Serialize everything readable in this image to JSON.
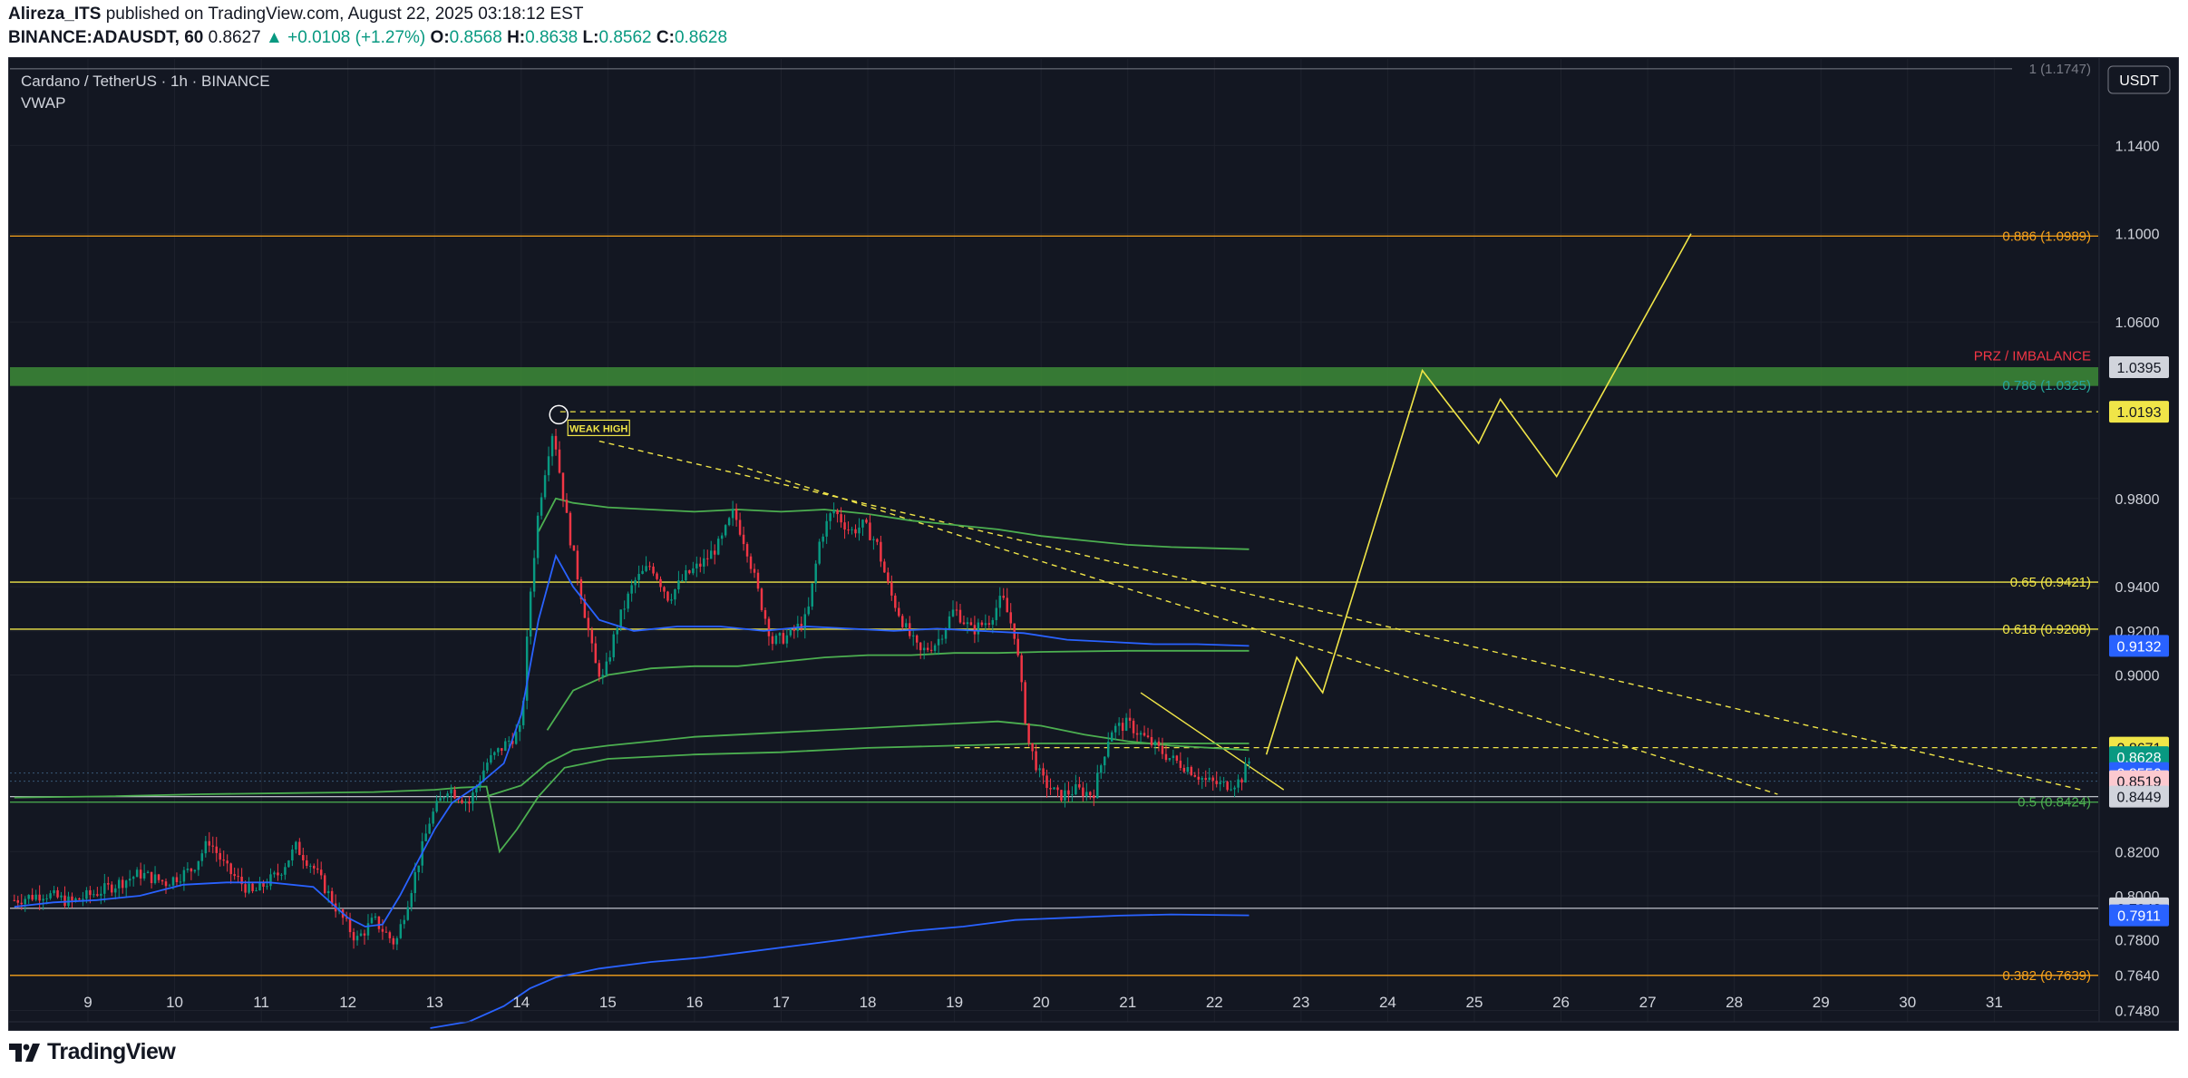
{
  "header": {
    "author": "Alireza_ITS",
    "published": "published on TradingView.com, August 22, 2025 03:18:12 EST",
    "symbol": "BINANCE:ADAUSDT, 60",
    "price": "0.8627",
    "change": "+0.0108 (+1.27%)",
    "o_label": "O:",
    "o": "0.8568",
    "h_label": "H:",
    "h": "0.8638",
    "l_label": "L:",
    "l": "0.8562",
    "c_label": "C:",
    "c": "0.8628"
  },
  "legend": {
    "title": "Cardano / TetherUS · 1h · BINANCE",
    "indicator": "VWAP"
  },
  "footer": {
    "brand": "TradingView"
  },
  "colors": {
    "bg": "#131722",
    "grid": "#1e222d",
    "up": "#089981",
    "down": "#f23645",
    "fib_orange": "#f7a21b",
    "fib_yellow": "#f0e548",
    "fib_green": "#4caf50",
    "vwap_blue": "#2962ff",
    "band_green": "#4caf50",
    "zone": "#3d8b37",
    "axis_text": "#d1d4dc"
  },
  "chart_data": {
    "type": "candlestick",
    "title": "Cardano / TetherUS · 1h · BINANCE",
    "x_axis": {
      "type": "date",
      "unit": "day",
      "range": [
        8.1,
        32.2
      ],
      "tick_labels": [
        "9",
        "10",
        "11",
        "12",
        "13",
        "14",
        "15",
        "16",
        "17",
        "18",
        "19",
        "20",
        "21",
        "22",
        "23",
        "24",
        "25",
        "26",
        "27",
        "28",
        "29",
        "30",
        "31"
      ]
    },
    "y_axis": {
      "currency": "USDT",
      "range": [
        0.74,
        1.18
      ],
      "tick_labels": [
        "1.1400",
        "1.1000",
        "1.0600",
        "0.9800",
        "0.9400",
        "0.9200",
        "0.9000",
        "0.8200",
        "0.8000",
        "0.7800",
        "0.7640",
        "0.7480"
      ]
    },
    "candle_path": [
      [
        8.15,
        0.798
      ],
      [
        8.5,
        0.801
      ],
      [
        8.8,
        0.797
      ],
      [
        9.2,
        0.803
      ],
      [
        9.6,
        0.81
      ],
      [
        9.9,
        0.806
      ],
      [
        10.2,
        0.812
      ],
      [
        10.4,
        0.825
      ],
      [
        10.6,
        0.812
      ],
      [
        10.9,
        0.801
      ],
      [
        11.2,
        0.81
      ],
      [
        11.4,
        0.822
      ],
      [
        11.6,
        0.813
      ],
      [
        11.9,
        0.792
      ],
      [
        12.1,
        0.78
      ],
      [
        12.3,
        0.789
      ],
      [
        12.55,
        0.778
      ],
      [
        12.75,
        0.806
      ],
      [
        12.95,
        0.835
      ],
      [
        13.15,
        0.849
      ],
      [
        13.4,
        0.842
      ],
      [
        13.6,
        0.86
      ],
      [
        13.85,
        0.87
      ],
      [
        14.0,
        0.875
      ],
      [
        14.1,
        0.935
      ],
      [
        14.2,
        0.975
      ],
      [
        14.3,
        0.999
      ],
      [
        14.37,
        1.012
      ],
      [
        14.45,
        0.99
      ],
      [
        14.55,
        0.965
      ],
      [
        14.7,
        0.935
      ],
      [
        14.85,
        0.905
      ],
      [
        14.95,
        0.898
      ],
      [
        15.1,
        0.922
      ],
      [
        15.3,
        0.942
      ],
      [
        15.5,
        0.95
      ],
      [
        15.7,
        0.935
      ],
      [
        15.9,
        0.945
      ],
      [
        16.1,
        0.951
      ],
      [
        16.3,
        0.96
      ],
      [
        16.45,
        0.974
      ],
      [
        16.6,
        0.958
      ],
      [
        16.75,
        0.935
      ],
      [
        16.9,
        0.915
      ],
      [
        17.1,
        0.918
      ],
      [
        17.3,
        0.926
      ],
      [
        17.45,
        0.962
      ],
      [
        17.6,
        0.975
      ],
      [
        17.8,
        0.965
      ],
      [
        17.95,
        0.968
      ],
      [
        18.1,
        0.96
      ],
      [
        18.25,
        0.938
      ],
      [
        18.45,
        0.92
      ],
      [
        18.6,
        0.91
      ],
      [
        18.8,
        0.915
      ],
      [
        19.0,
        0.93
      ],
      [
        19.2,
        0.92
      ],
      [
        19.4,
        0.925
      ],
      [
        19.55,
        0.935
      ],
      [
        19.7,
        0.918
      ],
      [
        19.85,
        0.87
      ],
      [
        20.0,
        0.853
      ],
      [
        20.2,
        0.845
      ],
      [
        20.4,
        0.848
      ],
      [
        20.6,
        0.846
      ],
      [
        20.8,
        0.875
      ],
      [
        21.0,
        0.878
      ],
      [
        21.15,
        0.873
      ],
      [
        21.3,
        0.868
      ],
      [
        21.5,
        0.862
      ],
      [
        21.7,
        0.858
      ],
      [
        21.9,
        0.852
      ],
      [
        22.1,
        0.85
      ],
      [
        22.3,
        0.852
      ],
      [
        22.42,
        0.8628
      ]
    ],
    "vwap_main": [
      [
        8.15,
        0.795
      ],
      [
        8.6,
        0.797
      ],
      [
        9.1,
        0.798
      ],
      [
        9.6,
        0.8
      ],
      [
        10.1,
        0.805
      ],
      [
        10.6,
        0.806
      ],
      [
        11.1,
        0.806
      ],
      [
        11.6,
        0.804
      ],
      [
        11.8,
        0.797
      ],
      [
        12.0,
        0.79
      ],
      [
        12.2,
        0.786
      ],
      [
        12.4,
        0.787
      ],
      [
        12.6,
        0.8
      ],
      [
        12.8,
        0.815
      ],
      [
        13.0,
        0.83
      ],
      [
        13.2,
        0.842
      ],
      [
        13.5,
        0.85
      ],
      [
        13.8,
        0.86
      ],
      [
        14.0,
        0.882
      ],
      [
        14.2,
        0.925
      ],
      [
        14.4,
        0.954
      ],
      [
        14.6,
        0.94
      ],
      [
        14.9,
        0.925
      ],
      [
        15.3,
        0.92
      ],
      [
        15.8,
        0.922
      ],
      [
        16.3,
        0.922
      ],
      [
        16.8,
        0.92
      ],
      [
        17.3,
        0.922
      ],
      [
        17.8,
        0.921
      ],
      [
        18.3,
        0.92
      ],
      [
        18.8,
        0.921
      ],
      [
        19.3,
        0.92
      ],
      [
        19.8,
        0.919
      ],
      [
        20.3,
        0.916
      ],
      [
        20.8,
        0.915
      ],
      [
        21.3,
        0.914
      ],
      [
        21.8,
        0.914
      ],
      [
        22.4,
        0.9132
      ]
    ],
    "vwap_low": [
      [
        12.95,
        0.74
      ],
      [
        13.4,
        0.743
      ],
      [
        13.8,
        0.75
      ],
      [
        14.1,
        0.758
      ],
      [
        14.4,
        0.763
      ],
      [
        14.9,
        0.767
      ],
      [
        15.5,
        0.77
      ],
      [
        16.1,
        0.772
      ],
      [
        16.7,
        0.775
      ],
      [
        17.3,
        0.778
      ],
      [
        17.9,
        0.781
      ],
      [
        18.5,
        0.784
      ],
      [
        19.1,
        0.786
      ],
      [
        19.7,
        0.789
      ],
      [
        20.3,
        0.79
      ],
      [
        20.9,
        0.791
      ],
      [
        21.5,
        0.7915
      ],
      [
        22.4,
        0.7911
      ]
    ],
    "band_upper1": [
      [
        14.2,
        0.965
      ],
      [
        14.4,
        0.98
      ],
      [
        14.6,
        0.978
      ],
      [
        15.0,
        0.976
      ],
      [
        15.5,
        0.975
      ],
      [
        16.0,
        0.974
      ],
      [
        16.5,
        0.975
      ],
      [
        17.0,
        0.974
      ],
      [
        17.5,
        0.975
      ],
      [
        18.0,
        0.973
      ],
      [
        18.5,
        0.97
      ],
      [
        19.0,
        0.968
      ],
      [
        19.5,
        0.966
      ],
      [
        20.0,
        0.963
      ],
      [
        20.5,
        0.961
      ],
      [
        21.0,
        0.959
      ],
      [
        21.5,
        0.958
      ],
      [
        22.4,
        0.957
      ]
    ],
    "band_upper2": [
      [
        14.3,
        0.875
      ],
      [
        14.6,
        0.893
      ],
      [
        15.0,
        0.9
      ],
      [
        15.5,
        0.903
      ],
      [
        16.0,
        0.904
      ],
      [
        16.5,
        0.904
      ],
      [
        17.0,
        0.906
      ],
      [
        17.5,
        0.908
      ],
      [
        18.0,
        0.909
      ],
      [
        18.5,
        0.909
      ],
      [
        19.0,
        0.91
      ],
      [
        19.5,
        0.91
      ],
      [
        20.0,
        0.9105
      ],
      [
        21.0,
        0.911
      ],
      [
        22.4,
        0.911
      ]
    ],
    "band_lower": [
      [
        13.6,
        0.845
      ],
      [
        14.0,
        0.85
      ],
      [
        14.3,
        0.86
      ],
      [
        14.6,
        0.866
      ],
      [
        15.0,
        0.868
      ],
      [
        15.5,
        0.87
      ],
      [
        16.0,
        0.872
      ],
      [
        16.5,
        0.873
      ],
      [
        17.0,
        0.874
      ],
      [
        17.5,
        0.875
      ],
      [
        18.0,
        0.876
      ],
      [
        18.5,
        0.877
      ],
      [
        19.0,
        0.878
      ],
      [
        19.5,
        0.879
      ],
      [
        20.0,
        0.877
      ],
      [
        20.5,
        0.873
      ],
      [
        21.0,
        0.87
      ],
      [
        21.5,
        0.868
      ],
      [
        22.4,
        0.866
      ]
    ],
    "band_lowest": [
      [
        8.15,
        0.8445
      ],
      [
        9.2,
        0.845
      ],
      [
        10.3,
        0.846
      ],
      [
        11.3,
        0.8465
      ],
      [
        12.3,
        0.847
      ],
      [
        13.0,
        0.848
      ],
      [
        13.3,
        0.849
      ],
      [
        13.6,
        0.8495
      ],
      [
        13.75,
        0.82
      ],
      [
        13.95,
        0.83
      ],
      [
        14.2,
        0.845
      ],
      [
        14.5,
        0.858
      ],
      [
        15.0,
        0.862
      ],
      [
        16.0,
        0.864
      ],
      [
        17.0,
        0.865
      ],
      [
        18.0,
        0.867
      ],
      [
        19.0,
        0.868
      ],
      [
        20.0,
        0.869
      ],
      [
        21.0,
        0.869
      ],
      [
        22.4,
        0.869
      ]
    ],
    "fib_levels": [
      {
        "label": "0.886 (1.0989)",
        "value": 1.0989,
        "color": "orange"
      },
      {
        "label": "PRZ / IMBALANCE",
        "value": 1.041,
        "color": "red"
      },
      {
        "label": "0.786 (1.0325)",
        "value": 1.0325,
        "color": "teal"
      },
      {
        "label": "0.65 (0.9421)",
        "value": 0.9421,
        "color": "yellow"
      },
      {
        "label": "0.618 (0.9208)",
        "value": 0.9208,
        "color": "yellow"
      },
      {
        "label": "0.5 (0.8424)",
        "value": 0.8424,
        "color": "green"
      },
      {
        "label": "0.382 (0.7639)",
        "value": 0.7639,
        "color": "orange"
      }
    ],
    "top_right_label": "1 (1.1747)",
    "zone": {
      "from": 1.031,
      "to": 1.0395
    },
    "price_badges": [
      {
        "text": "1.0395",
        "value": 1.0395,
        "bg": "#d1d4dc",
        "fg": "#131722"
      },
      {
        "text": "1.0193",
        "value": 1.0193,
        "bg": "#f0e548",
        "fg": "#131722"
      },
      {
        "text": "0.9132",
        "value": 0.9132,
        "bg": "#2962ff",
        "fg": "#ffffff"
      },
      {
        "text": "0.8671",
        "value": 0.8671,
        "bg": "#f0e548",
        "fg": "#131722"
      },
      {
        "text": "0.8628",
        "value": 0.8628,
        "bg": "#089981",
        "fg": "#ffffff",
        "sub": "41:49"
      },
      {
        "text": "0.8556",
        "value": 0.8556,
        "bg": "#2962ff",
        "fg": "#ffffff"
      },
      {
        "text": "0.8519",
        "value": 0.8519,
        "bg": "#fcc9cf",
        "fg": "#131722"
      },
      {
        "text": "0.8449",
        "value": 0.8449,
        "bg": "#d1d4dc",
        "fg": "#131722"
      },
      {
        "text": "0.7943",
        "value": 0.7943,
        "bg": "#d1d4dc",
        "fg": "#131722"
      },
      {
        "text": "0.7911",
        "value": 0.7911,
        "bg": "#2962ff",
        "fg": "#ffffff"
      }
    ],
    "dashed_lines": [
      {
        "value": 1.0193,
        "from_x": 14.45,
        "to_x": 32.2,
        "color": "yellow"
      },
      {
        "value": 0.8671,
        "from_x": 19.0,
        "to_x": 32.2,
        "color": "yellow"
      }
    ],
    "trendlines": [
      {
        "points": [
          [
            14.9,
            1.006
          ],
          [
            32.0,
            0.848
          ]
        ],
        "dashed": true
      },
      {
        "points": [
          [
            16.5,
            0.995
          ],
          [
            28.5,
            0.846
          ]
        ],
        "dashed": true
      },
      {
        "points": [
          [
            21.15,
            0.892
          ],
          [
            22.8,
            0.848
          ]
        ],
        "dashed": false
      }
    ],
    "projection_path": [
      [
        22.6,
        0.864
      ],
      [
        22.95,
        0.908
      ],
      [
        23.25,
        0.892
      ],
      [
        24.4,
        1.038
      ],
      [
        25.05,
        1.005
      ],
      [
        25.3,
        1.025
      ],
      [
        25.95,
        0.99
      ],
      [
        27.5,
        1.1
      ]
    ],
    "annotation": {
      "text": "WEAK HIGH",
      "x": 14.35,
      "value": 1.0155
    },
    "hlines_white": [
      {
        "value": 0.8449
      },
      {
        "value": 0.7943
      }
    ]
  }
}
